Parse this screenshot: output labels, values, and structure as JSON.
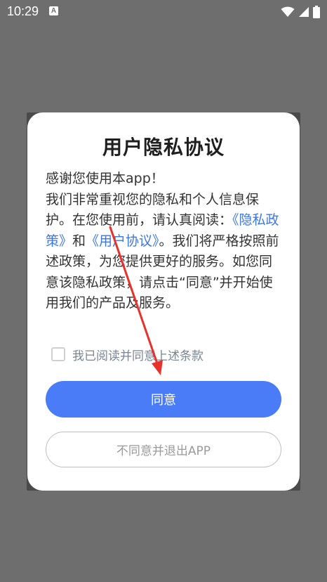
{
  "status_bar": {
    "time": "10:29",
    "notification_glyph": "A",
    "icons": [
      "wifi-icon",
      "signal-icon",
      "battery-icon"
    ]
  },
  "dialog": {
    "title": "用户隐私协议",
    "greeting": "感谢您使用本app！",
    "body_part1": "我们非常重视您的隐私和个人信息保护。在您使用前，请认真阅读：",
    "privacy_link": "《隐私政策》",
    "and_text": "和",
    "agreement_link": "《用户协议》",
    "body_part2": "。我们将严格按照前述政策，为您提供更好的服务。如您同意该隐私政策，请点击“同意”并开始使用我们的产品及服务。",
    "checkbox_label": "我已阅读并同意上述条款",
    "checkbox_checked": false,
    "agree_button": "同意",
    "disagree_button": "不同意并退出APP"
  },
  "colors": {
    "accent": "#4a7cf7",
    "link": "#3c77e6",
    "annotation_arrow": "#e8312a",
    "backdrop": "#6e6e6e"
  }
}
